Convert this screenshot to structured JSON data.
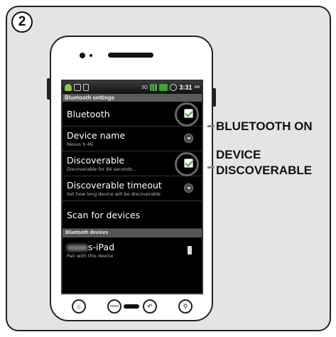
{
  "step_number": "2",
  "status_bar": {
    "time": "3:31",
    "ampm": "AM",
    "network": "3G"
  },
  "screen_title": "Bluetooth settings",
  "settings": {
    "bluetooth": {
      "label": "Bluetooth"
    },
    "device_name": {
      "label": "Device name",
      "value": "Nexus S 4G"
    },
    "discoverable": {
      "label": "Discoverable",
      "summary": "Discoverable for 84 seconds..."
    },
    "discoverable_timeout": {
      "label": "Discoverable timeout",
      "summary": "Set how long device will be discoverable"
    },
    "scan": {
      "label": "Scan for devices"
    }
  },
  "devices_header": "Bluetooth devices",
  "device": {
    "name_suffix": "s-iPad",
    "summary": "Pair with this device"
  },
  "navbar": {
    "home": "⌂",
    "menu": "menu",
    "back": "↶",
    "search": "⚲"
  },
  "callouts": {
    "bluetooth_on": "BLUETOOTH ON",
    "discoverable_line1": "DEVICE",
    "discoverable_line2": "DISCOVERABLE"
  },
  "colors": {
    "check_green": "#3fa72e",
    "ring_gray": "#666666",
    "panel_bg": "#e4e4e4"
  },
  "icons": [
    "android-icon",
    "usb-icon",
    "sd-card-icon",
    "signal-icon",
    "battery-icon",
    "alarm-icon"
  ]
}
